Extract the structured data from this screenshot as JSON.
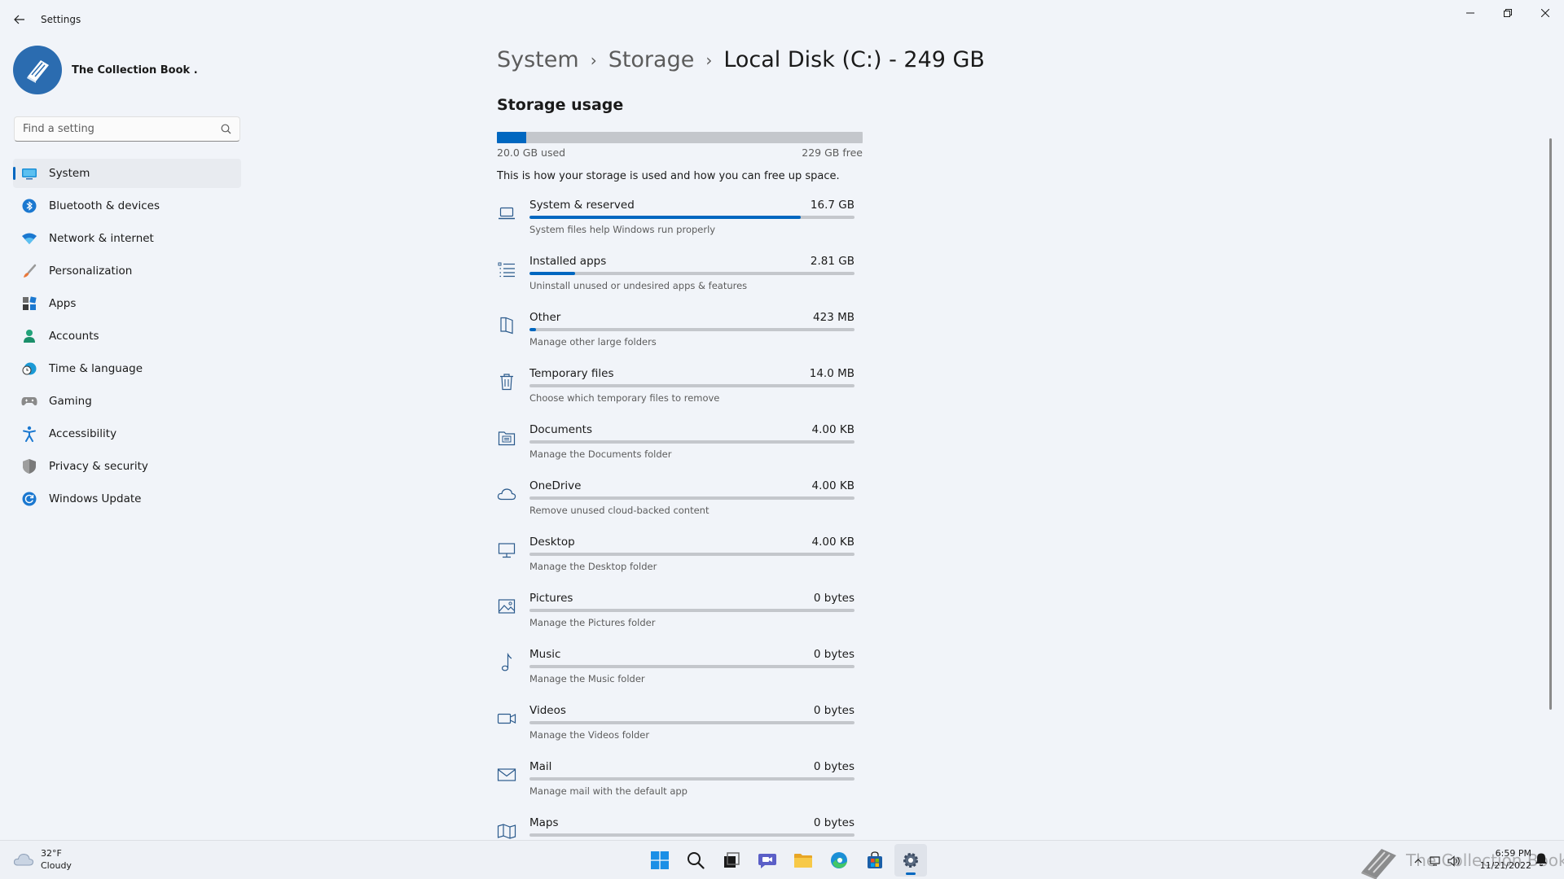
{
  "window": {
    "title": "Settings",
    "colors": {
      "accent": "#0067c0",
      "bar_track": "#c4c7cc",
      "background": "#f1f4f9"
    }
  },
  "profile": {
    "name": "The Collection Book ."
  },
  "search": {
    "placeholder": "Find a setting"
  },
  "nav": {
    "items": [
      {
        "label": "System",
        "icon": "monitor-icon",
        "active": true
      },
      {
        "label": "Bluetooth & devices",
        "icon": "bluetooth-icon"
      },
      {
        "label": "Network & internet",
        "icon": "wifi-icon"
      },
      {
        "label": "Personalization",
        "icon": "brush-icon"
      },
      {
        "label": "Apps",
        "icon": "apps-icon"
      },
      {
        "label": "Accounts",
        "icon": "person-icon"
      },
      {
        "label": "Time & language",
        "icon": "clock-globe-icon"
      },
      {
        "label": "Gaming",
        "icon": "gamepad-icon"
      },
      {
        "label": "Accessibility",
        "icon": "accessibility-icon"
      },
      {
        "label": "Privacy & security",
        "icon": "shield-icon"
      },
      {
        "label": "Windows Update",
        "icon": "update-icon"
      }
    ]
  },
  "breadcrumb": {
    "items": [
      "System",
      "Storage",
      "Local Disk (C:) - 249 GB"
    ],
    "separator": "›"
  },
  "storage": {
    "section_title": "Storage usage",
    "used_label": "20.0 GB used",
    "free_label": "229 GB free",
    "used_fraction": 0.08,
    "description": "This is how your storage is used and how you can free up space.",
    "categories": [
      {
        "name": "System & reserved",
        "size": "16.7 GB",
        "desc": "System files help Windows run properly",
        "fill": 0.835,
        "icon": "laptop-icon"
      },
      {
        "name": "Installed apps",
        "size": "2.81 GB",
        "desc": "Uninstall unused or undesired apps & features",
        "fill": 0.14,
        "icon": "list-icon"
      },
      {
        "name": "Other",
        "size": "423 MB",
        "desc": "Manage other large folders",
        "fill": 0.021,
        "icon": "folder-open-icon"
      },
      {
        "name": "Temporary files",
        "size": "14.0 MB",
        "desc": "Choose which temporary files to remove",
        "fill": 0,
        "icon": "trash-icon"
      },
      {
        "name": "Documents",
        "size": "4.00 KB",
        "desc": "Manage the Documents folder",
        "fill": 0,
        "icon": "documents-folder-icon"
      },
      {
        "name": "OneDrive",
        "size": "4.00 KB",
        "desc": "Remove unused cloud-backed content",
        "fill": 0,
        "icon": "cloud-icon"
      },
      {
        "name": "Desktop",
        "size": "4.00 KB",
        "desc": "Manage the Desktop folder",
        "fill": 0,
        "icon": "desktop-icon"
      },
      {
        "name": "Pictures",
        "size": "0 bytes",
        "desc": "Manage the Pictures folder",
        "fill": 0,
        "icon": "image-icon"
      },
      {
        "name": "Music",
        "size": "0 bytes",
        "desc": "Manage the Music folder",
        "fill": 0,
        "icon": "music-note-icon"
      },
      {
        "name": "Videos",
        "size": "0 bytes",
        "desc": "Manage the Videos folder",
        "fill": 0,
        "icon": "video-camera-icon"
      },
      {
        "name": "Mail",
        "size": "0 bytes",
        "desc": "Manage mail with the default app",
        "fill": 0,
        "icon": "mail-icon"
      },
      {
        "name": "Maps",
        "size": "0 bytes",
        "desc": "",
        "fill": 0,
        "icon": "map-icon"
      }
    ]
  },
  "taskbar": {
    "weather": {
      "temp": "32°F",
      "condition": "Cloudy",
      "icon": "cloud-icon"
    },
    "apps": [
      {
        "icon": "windows-start-icon"
      },
      {
        "icon": "search-icon"
      },
      {
        "icon": "task-view-icon"
      },
      {
        "icon": "teams-chat-icon"
      },
      {
        "icon": "file-explorer-icon"
      },
      {
        "icon": "edge-icon"
      },
      {
        "icon": "store-icon"
      },
      {
        "icon": "settings-gear-icon",
        "active": true
      }
    ],
    "watermark": "The Collection Book",
    "clock": {
      "time": "6:59 PM",
      "date": "11/21/2022"
    }
  }
}
